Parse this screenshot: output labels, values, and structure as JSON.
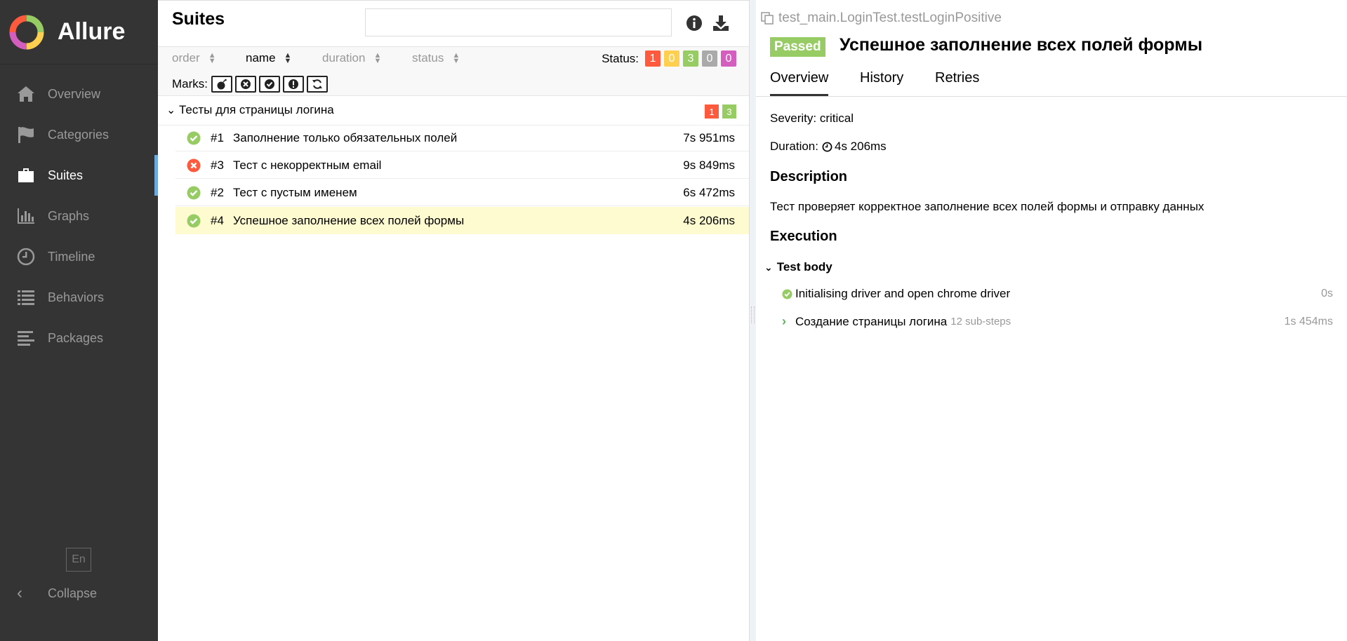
{
  "brand": {
    "name": "Allure"
  },
  "sidebar": {
    "items": [
      {
        "label": "Overview",
        "icon": "home-icon"
      },
      {
        "label": "Categories",
        "icon": "flag-icon"
      },
      {
        "label": "Suites",
        "icon": "briefcase-icon",
        "active": true
      },
      {
        "label": "Graphs",
        "icon": "bar-chart-icon"
      },
      {
        "label": "Timeline",
        "icon": "clock-icon"
      },
      {
        "label": "Behaviors",
        "icon": "list-icon"
      },
      {
        "label": "Packages",
        "icon": "align-left-icon"
      }
    ],
    "language": "En",
    "collapse_label": "Collapse"
  },
  "suites": {
    "title": "Suites",
    "search_placeholder": "",
    "sort": {
      "order": "order",
      "name": "name",
      "duration": "duration",
      "status": "status"
    },
    "status_label": "Status:",
    "status_counts": [
      {
        "value": "1",
        "color": "#fd5a3e"
      },
      {
        "value": "0",
        "color": "#ffd050"
      },
      {
        "value": "3",
        "color": "#97cc64"
      },
      {
        "value": "0",
        "color": "#aaaaaa"
      },
      {
        "value": "0",
        "color": "#d35ebe"
      }
    ],
    "marks_label": "Marks:",
    "group": {
      "title": "Тесты для страницы логина",
      "failed": "1",
      "passed": "3"
    },
    "rows": [
      {
        "status": "passed",
        "num": "#1",
        "name": "Заполнение только обязательных полей",
        "duration": "7s 951ms"
      },
      {
        "status": "failed",
        "num": "#3",
        "name": "Тест с некорректным email",
        "duration": "9s 849ms"
      },
      {
        "status": "passed",
        "num": "#2",
        "name": "Тест с пустым именем",
        "duration": "6s 472ms"
      },
      {
        "status": "passed",
        "num": "#4",
        "name": "Успешное заполнение всех полей формы",
        "duration": "4s 206ms",
        "selected": true
      }
    ]
  },
  "detail": {
    "full_name": "test_main.LoginTest.testLoginPositive",
    "status_badge": "Passed",
    "title": "Успешное заполнение всех полей формы",
    "tabs": [
      "Overview",
      "History",
      "Retries"
    ],
    "severity": "Severity: critical",
    "duration_label": "Duration:",
    "duration_value": "4s 206ms",
    "description_heading": "Description",
    "description": "Тест проверяет корректное заполнение всех полей формы и отправку данных",
    "execution_heading": "Execution",
    "test_body": "Test body",
    "steps": [
      {
        "name": "Initialising driver and open chrome driver",
        "substeps": "",
        "time": "0s"
      },
      {
        "name": "Создание страницы логина",
        "substeps": "12 sub-steps",
        "time": "1s 454ms"
      }
    ]
  },
  "colors": {
    "sidebar_bg": "#343434",
    "accent": "#6ca9de",
    "passed": "#97cc64",
    "failed": "#fd5a3e",
    "selected_row": "#fffbd0"
  }
}
